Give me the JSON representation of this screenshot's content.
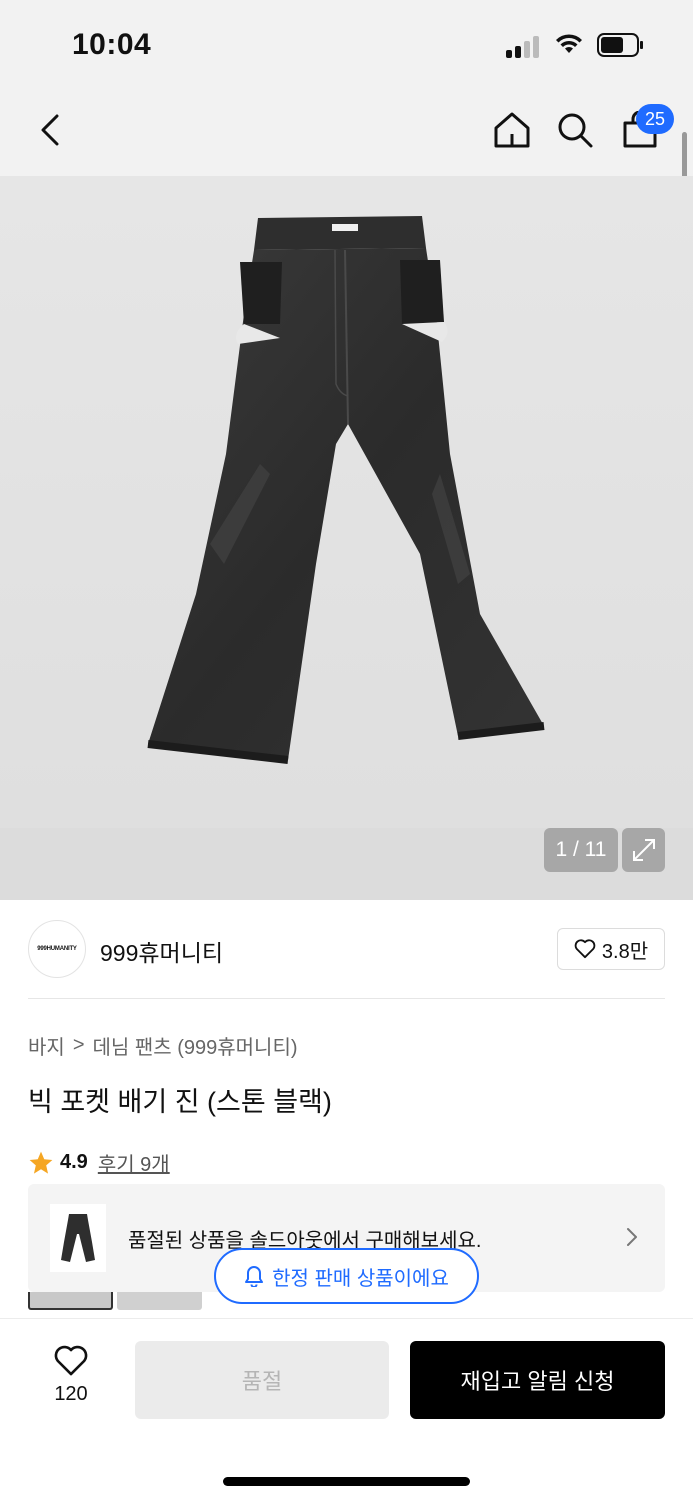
{
  "status_bar": {
    "time": "10:04"
  },
  "nav": {
    "cart_count": "25"
  },
  "gallery": {
    "counter": "1 / 11"
  },
  "brand": {
    "logo_text": "999HUMANITY",
    "name": "999휴머니티",
    "like_count": "3.8만"
  },
  "breadcrumb": {
    "category": "바지",
    "separator": ">",
    "subcategory": "데님 팬츠 (999휴머니티)"
  },
  "product": {
    "title": "빅 포켓 배기 진 (스톤 블랙)"
  },
  "rating": {
    "value": "4.9",
    "reviews": "후기 9개"
  },
  "soldout_banner": {
    "text": "품절된 상품을 솔드아웃에서 구매해보세요."
  },
  "limited_notice": {
    "text": "한정 판매 상품이에요"
  },
  "bottom_bar": {
    "wish_count": "120",
    "soldout_label": "품절",
    "restock_label": "재입고 알림 신청"
  },
  "colors": {
    "accent_blue": "#1f6bff",
    "star": "#f5a623",
    "primary_button": "#000000",
    "disabled_button": "#ebebeb"
  }
}
